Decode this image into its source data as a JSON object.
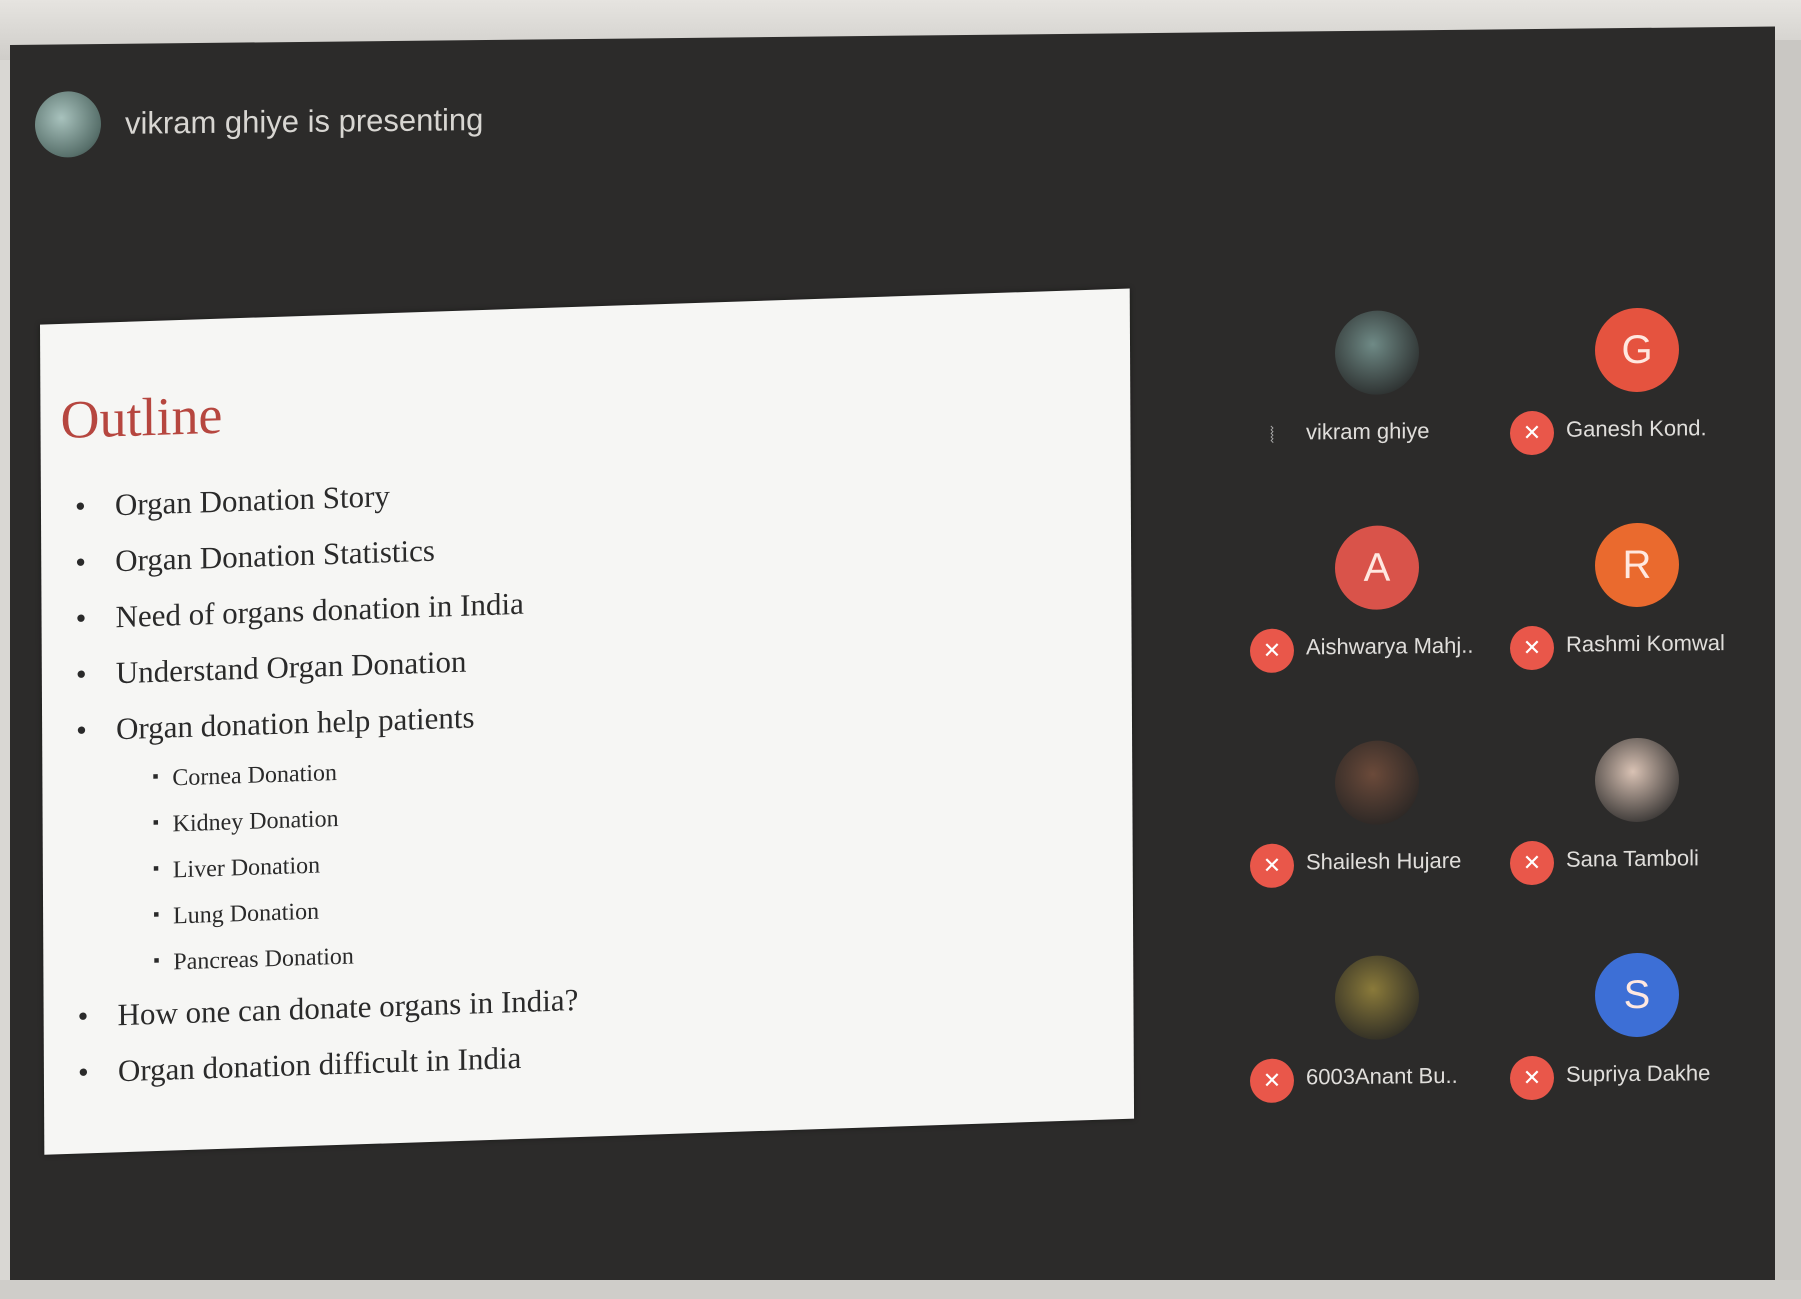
{
  "presenter": {
    "text": "vikram ghiye is presenting",
    "avatar_icon": "person-photo-icon"
  },
  "slide": {
    "title": "Outline",
    "title_color": "#b6463f",
    "bullets": [
      {
        "text": "Organ Donation Story",
        "level": 1
      },
      {
        "text": "Organ Donation Statistics",
        "level": 1
      },
      {
        "text": "Need of organs donation in India",
        "level": 1
      },
      {
        "text": "Understand Organ Donation",
        "level": 1
      },
      {
        "text": "Organ donation help patients",
        "level": 1
      },
      {
        "text": "Cornea Donation",
        "level": 2
      },
      {
        "text": "Kidney Donation",
        "level": 2
      },
      {
        "text": "Liver Donation",
        "level": 2
      },
      {
        "text": "Lung Donation",
        "level": 2
      },
      {
        "text": "Pancreas Donation",
        "level": 2
      },
      {
        "text": "How one can donate organs in India?",
        "level": 1
      },
      {
        "text": "Organ donation difficult in India",
        "level": 1
      }
    ]
  },
  "participants": [
    {
      "name": "vikram ghiye",
      "initial": "",
      "avatar_color": "#6f8a86",
      "photo": true,
      "mic": "active"
    },
    {
      "name": "Ganesh Kond.",
      "initial": "G",
      "avatar_color": "#e5533f",
      "photo": false,
      "mic": "muted"
    },
    {
      "name": "Aishwarya Mahj..",
      "initial": "A",
      "avatar_color": "#d9534a",
      "photo": false,
      "mic": "muted"
    },
    {
      "name": "Rashmi Komwal",
      "initial": "R",
      "avatar_color": "#ea6a2e",
      "photo": false,
      "mic": "muted"
    },
    {
      "name": "Shailesh Hujare",
      "initial": "",
      "avatar_color": "#6b4a3a",
      "photo": true,
      "mic": "muted"
    },
    {
      "name": "Sana Tamboli",
      "initial": "",
      "avatar_color": "#d9c2b4",
      "photo": true,
      "mic": "muted"
    },
    {
      "name": "6003Anant Bu..",
      "initial": "",
      "avatar_color": "#8a7a3a",
      "photo": true,
      "mic": "muted"
    },
    {
      "name": "Supriya Dakhe",
      "initial": "S",
      "avatar_color": "#3d6fd6",
      "photo": false,
      "mic": "muted"
    }
  ]
}
